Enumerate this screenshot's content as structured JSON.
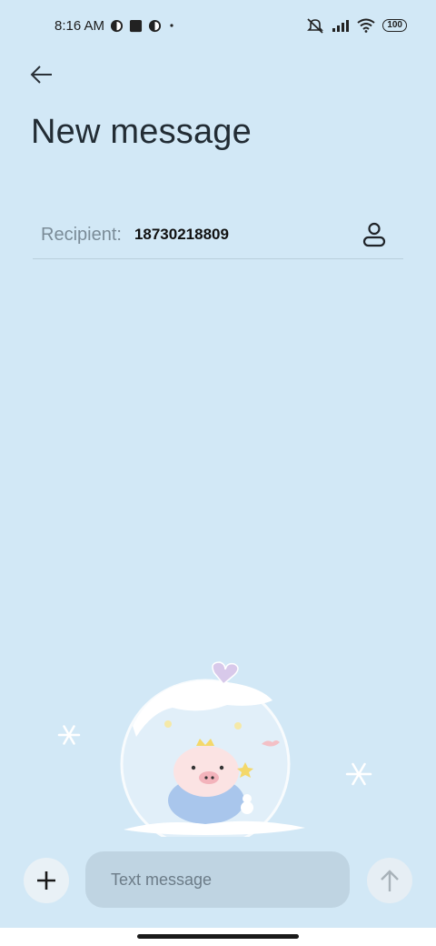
{
  "status_bar": {
    "time": "8:16 AM",
    "battery": "100",
    "icons": [
      "notification-icon",
      "square-icon",
      "notification-icon",
      "dot-icon",
      "mute-icon",
      "signal-icon",
      "wifi-icon",
      "battery-icon"
    ]
  },
  "header": {
    "back_icon": "arrow-left-icon",
    "title": "New message"
  },
  "recipient": {
    "label": "Recipient:",
    "value": "18730218809",
    "contact_icon": "person-icon"
  },
  "composer": {
    "add_icon": "plus-icon",
    "placeholder": "Text message",
    "value": "",
    "send_icon": "arrow-up-icon"
  },
  "colors": {
    "background": "#d2e8f6",
    "input_bg": "#bfd4e2",
    "button_bg": "#e9f1f6"
  }
}
